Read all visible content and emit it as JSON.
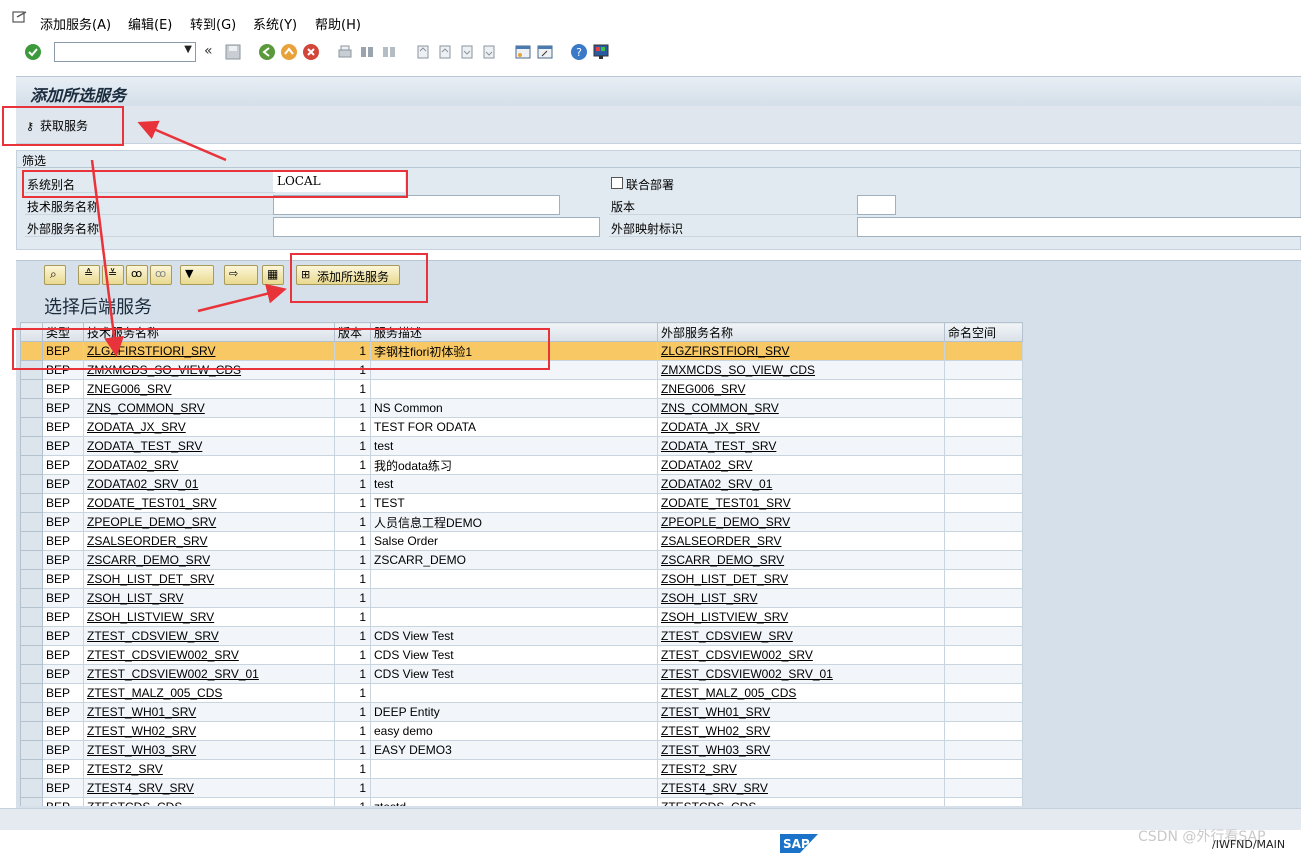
{
  "menu": {
    "items": [
      "添加服务(A)",
      "编辑(E)",
      "转到(G)",
      "系统(Y)",
      "帮助(H)"
    ]
  },
  "page": {
    "title": "添加所选服务",
    "get_services_label": "获取服务"
  },
  "filter": {
    "group_title": "筛选",
    "system_alias_label": "系统别名",
    "system_alias_value": "LOCAL",
    "tech_service_label": "技术服务名称",
    "tech_service_value": "",
    "ext_service_label": "外部服务名称",
    "ext_service_value": "",
    "co_deploy_label": "联合部署",
    "version_label": "版本",
    "version_value": "",
    "ext_mapping_label": "外部映射标识",
    "ext_mapping_value": ""
  },
  "results": {
    "add_selected_label": "添加所选服务",
    "grid_title": "选择后端服务",
    "columns": [
      "类型",
      "技术服务名称",
      "版本",
      "服务描述",
      "外部服务名称",
      "命名空间"
    ],
    "rows": [
      [
        "BEP",
        "ZLGZFIRSTFIORI_SRV",
        "1",
        "李钢柱fiori初体验1",
        "ZLGZFIRSTFIORI_SRV",
        ""
      ],
      [
        "BEP",
        "ZMXMCDS_SO_VIEW_CDS",
        "1",
        "",
        "ZMXMCDS_SO_VIEW_CDS",
        ""
      ],
      [
        "BEP",
        "ZNEG006_SRV",
        "1",
        "",
        "ZNEG006_SRV",
        ""
      ],
      [
        "BEP",
        "ZNS_COMMON_SRV",
        "1",
        "NS Common",
        "ZNS_COMMON_SRV",
        ""
      ],
      [
        "BEP",
        "ZODATA_JX_SRV",
        "1",
        "TEST FOR ODATA",
        "ZODATA_JX_SRV",
        ""
      ],
      [
        "BEP",
        "ZODATA_TEST_SRV",
        "1",
        "test",
        "ZODATA_TEST_SRV",
        ""
      ],
      [
        "BEP",
        "ZODATA02_SRV",
        "1",
        "我的odata练习",
        "ZODATA02_SRV",
        ""
      ],
      [
        "BEP",
        "ZODATA02_SRV_01",
        "1",
        "test",
        "ZODATA02_SRV_01",
        ""
      ],
      [
        "BEP",
        "ZODATE_TEST01_SRV",
        "1",
        "TEST",
        "ZODATE_TEST01_SRV",
        ""
      ],
      [
        "BEP",
        "ZPEOPLE_DEMO_SRV",
        "1",
        "人员信息工程DEMO",
        "ZPEOPLE_DEMO_SRV",
        ""
      ],
      [
        "BEP",
        "ZSALSEORDER_SRV",
        "1",
        "Salse Order",
        "ZSALSEORDER_SRV",
        ""
      ],
      [
        "BEP",
        "ZSCARR_DEMO_SRV",
        "1",
        "ZSCARR_DEMO",
        "ZSCARR_DEMO_SRV",
        ""
      ],
      [
        "BEP",
        "ZSOH_LIST_DET_SRV",
        "1",
        "",
        "ZSOH_LIST_DET_SRV",
        ""
      ],
      [
        "BEP",
        "ZSOH_LIST_SRV",
        "1",
        "",
        "ZSOH_LIST_SRV",
        ""
      ],
      [
        "BEP",
        "ZSOH_LISTVIEW_SRV",
        "1",
        "",
        "ZSOH_LISTVIEW_SRV",
        ""
      ],
      [
        "BEP",
        "ZTEST_CDSVIEW_SRV",
        "1",
        "CDS View Test",
        "ZTEST_CDSVIEW_SRV",
        ""
      ],
      [
        "BEP",
        "ZTEST_CDSVIEW002_SRV",
        "1",
        "CDS View Test",
        "ZTEST_CDSVIEW002_SRV",
        ""
      ],
      [
        "BEP",
        "ZTEST_CDSVIEW002_SRV_01",
        "1",
        "CDS View Test",
        "ZTEST_CDSVIEW002_SRV_01",
        ""
      ],
      [
        "BEP",
        "ZTEST_MALZ_005_CDS",
        "1",
        "",
        "ZTEST_MALZ_005_CDS",
        ""
      ],
      [
        "BEP",
        "ZTEST_WH01_SRV",
        "1",
        "DEEP Entity",
        "ZTEST_WH01_SRV",
        ""
      ],
      [
        "BEP",
        "ZTEST_WH02_SRV",
        "1",
        "easy demo",
        "ZTEST_WH02_SRV",
        ""
      ],
      [
        "BEP",
        "ZTEST_WH03_SRV",
        "1",
        "EASY DEMO3",
        "ZTEST_WH03_SRV",
        ""
      ],
      [
        "BEP",
        "ZTEST2_SRV",
        "1",
        "",
        "ZTEST2_SRV",
        ""
      ],
      [
        "BEP",
        "ZTEST4_SRV_SRV",
        "1",
        "",
        "ZTEST4_SRV_SRV",
        ""
      ],
      [
        "BEP",
        "ZTESTCDS_CDS",
        "1",
        "ztestd",
        "ZTESTCDS_CDS",
        ""
      ]
    ]
  },
  "status": {
    "system_info": "/IWFND/MAIN",
    "watermark": "CSDN @外行看SAP",
    "logo_text": "SAP"
  },
  "colors": {
    "selected_row": "#f8c865",
    "annotation_red": "#e8333a"
  }
}
